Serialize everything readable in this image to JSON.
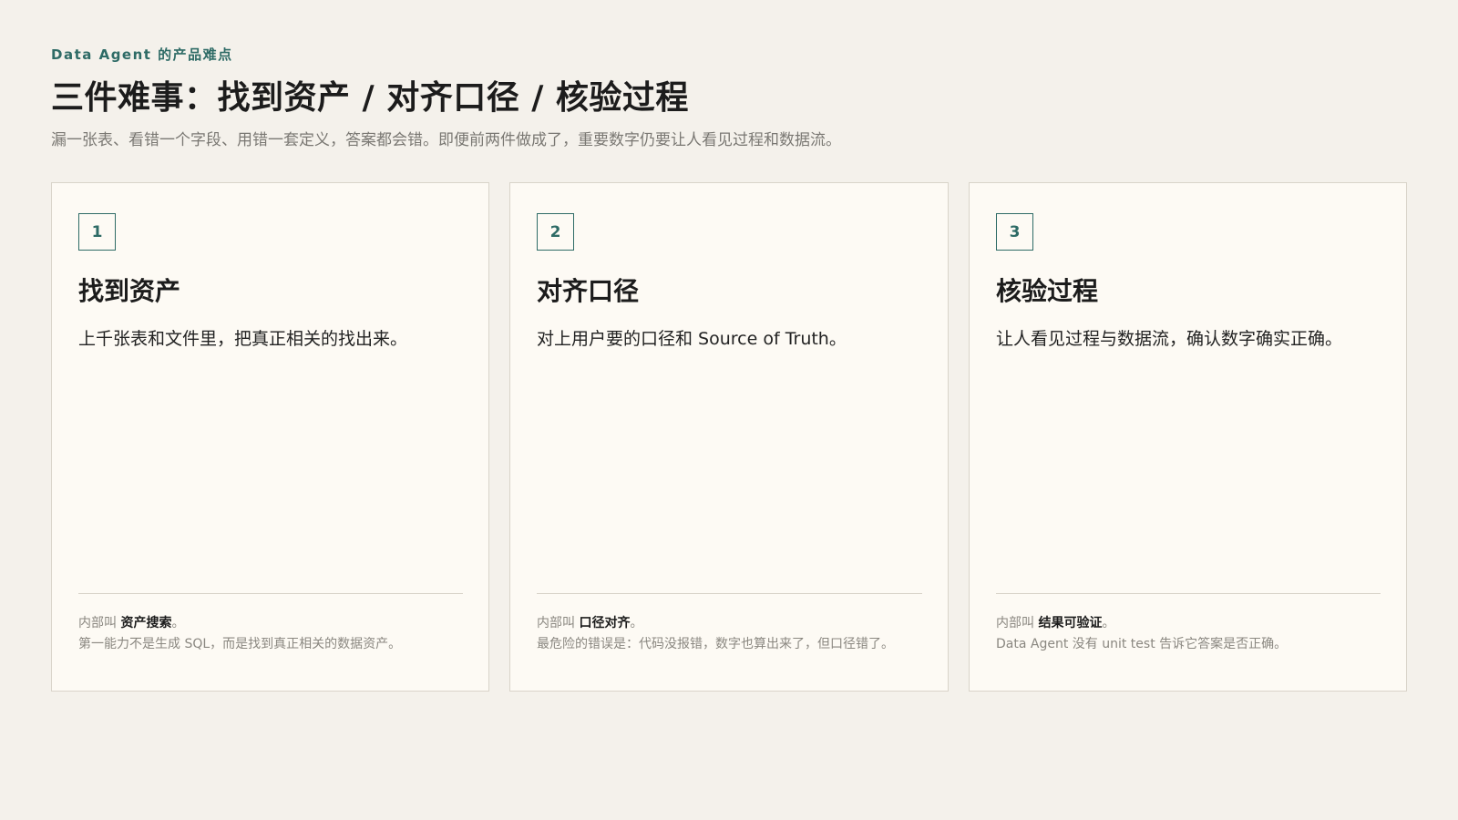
{
  "header": {
    "eyebrow": "Data Agent 的产品难点",
    "title": "三件难事：找到资产 / 对齐口径 / 核验过程",
    "subtitle": "漏一张表、看错一个字段、用错一套定义，答案都会错。即便前两件做成了，重要数字仍要让人看见过程和数据流。"
  },
  "cards": [
    {
      "number": "1",
      "heading": "找到资产",
      "description": "上千张表和文件里，把真正相关的找出来。",
      "note_prefix": "内部叫",
      "note_term": "资产搜索",
      "note_suffix": "。",
      "note_detail": "第一能力不是生成 SQL，而是找到真正相关的数据资产。"
    },
    {
      "number": "2",
      "heading": "对齐口径",
      "description": "对上用户要的口径和 Source of Truth。",
      "note_prefix": "内部叫",
      "note_term": "口径对齐",
      "note_suffix": "。",
      "note_detail": "最危险的错误是：代码没报错，数字也算出来了，但口径错了。"
    },
    {
      "number": "3",
      "heading": "核验过程",
      "description": "让人看见过程与数据流，确认数字确实正确。",
      "note_prefix": "内部叫",
      "note_term": "结果可验证",
      "note_suffix": "。",
      "note_detail": "Data Agent 没有 unit test 告诉它答案是否正确。"
    }
  ]
}
